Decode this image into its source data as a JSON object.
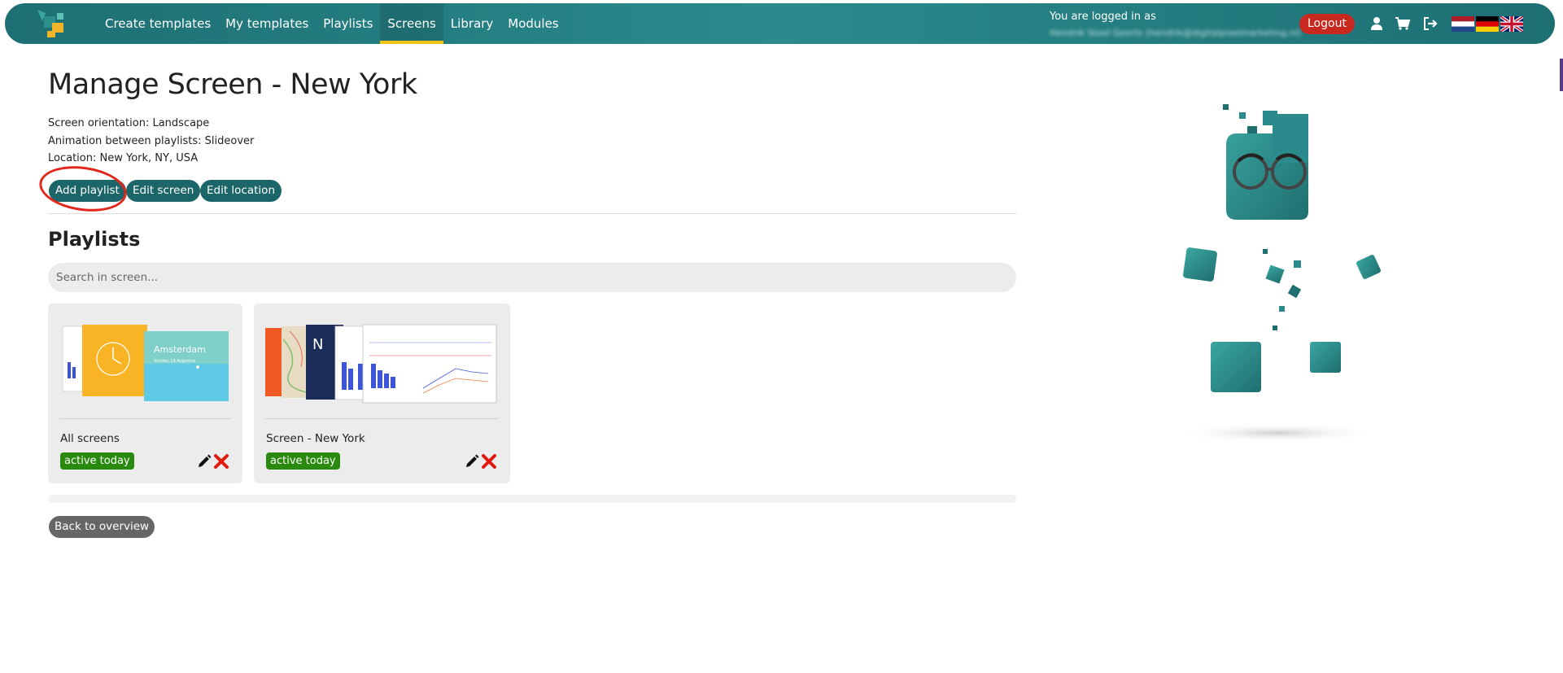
{
  "nav": {
    "links": [
      "Create templates",
      "My templates",
      "Playlists",
      "Screens",
      "Library",
      "Modules"
    ],
    "active": "Screens",
    "login_label": "You are logged in as",
    "login_user": "Hendrik Stoel Geerts (hendrik@digitalpixelmarketing.nl)",
    "logout_label": "Logout",
    "icons": [
      "user-icon",
      "cart-icon",
      "sign-out-icon"
    ],
    "flags": [
      "flag-nl",
      "flag-de",
      "flag-uk"
    ]
  },
  "page": {
    "title": "Manage Screen -  New York",
    "orientation": "Screen orientation: Landscape",
    "animation": "Animation between playlists: Slideover",
    "location": "Location: New York,  NY, USA"
  },
  "actions": {
    "add_playlist": "Add playlist",
    "edit_screen": "Edit screen",
    "edit_location": "Edit location"
  },
  "playlists": {
    "heading": "Playlists",
    "search_placeholder": "Search in screen...",
    "items": [
      {
        "name": "All screens",
        "status": "active today",
        "thumbnail_text": "Amsterdam",
        "thumbnail_subtext": "Sunday  19 Augustus"
      },
      {
        "name": "Screen -  New York",
        "status": "active today",
        "thumbnail_text": "N"
      }
    ]
  },
  "footer": {
    "back_label": "Back to overview"
  },
  "colors": {
    "nav_bg": "#1d6f73",
    "active_underline": "#f0c419",
    "button_teal": "#1c6568",
    "logout_red": "#c8281e",
    "badge_green": "#2a8a0f",
    "annotation_red": "#e1261c"
  }
}
